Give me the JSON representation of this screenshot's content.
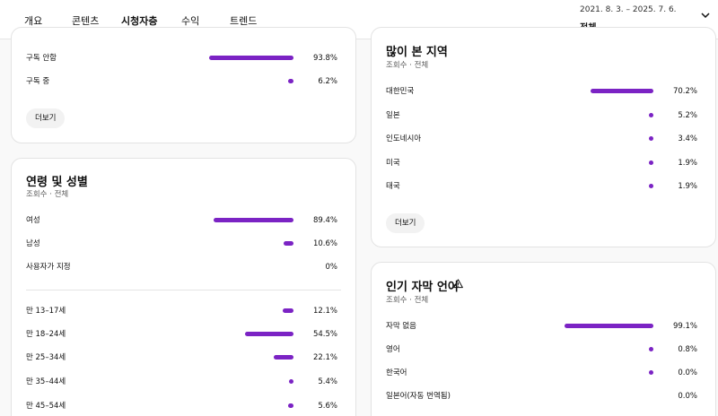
{
  "tabs": [
    {
      "label": "개요",
      "active": false
    },
    {
      "label": "콘텐츠",
      "active": false
    },
    {
      "label": "시청자층",
      "active": true
    },
    {
      "label": "수익",
      "active": false
    },
    {
      "label": "트렌드",
      "active": false
    }
  ],
  "date_range": {
    "dates": "2021. 8. 3. – 2025. 7. 6.",
    "scope": "전체"
  },
  "subscription_card": {
    "rows": [
      {
        "label": "구독 안함",
        "value": 93.8,
        "display": "93.8%"
      },
      {
        "label": "구독 중",
        "value": 6.2,
        "display": "6.2%"
      }
    ],
    "more_label": "더보기"
  },
  "age_gender_card": {
    "title": "연령 및 성별",
    "subtitle": "조회수 · 전체",
    "gender_rows": [
      {
        "label": "여성",
        "value": 89.4,
        "display": "89.4%"
      },
      {
        "label": "남성",
        "value": 10.6,
        "display": "10.6%"
      },
      {
        "label": "사용자가 지정",
        "value": 0,
        "display": "0%"
      }
    ],
    "age_rows": [
      {
        "label": "만 13–17세",
        "value": 12.1,
        "display": "12.1%"
      },
      {
        "label": "만 18–24세",
        "value": 54.5,
        "display": "54.5%"
      },
      {
        "label": "만 25–34세",
        "value": 22.1,
        "display": "22.1%"
      },
      {
        "label": "만 35–44세",
        "value": 5.4,
        "display": "5.4%"
      },
      {
        "label": "만 45–54세",
        "value": 5.6,
        "display": "5.6%"
      }
    ]
  },
  "geography_card": {
    "title": "많이 본 지역",
    "subtitle": "조회수 · 전체",
    "rows": [
      {
        "label": "대한민국",
        "value": 70.2,
        "display": "70.2%"
      },
      {
        "label": "일본",
        "value": 5.2,
        "display": "5.2%"
      },
      {
        "label": "인도네시아",
        "value": 3.4,
        "display": "3.4%"
      },
      {
        "label": "미국",
        "value": 1.9,
        "display": "1.9%"
      },
      {
        "label": "태국",
        "value": 1.9,
        "display": "1.9%"
      }
    ],
    "more_label": "더보기"
  },
  "subtitle_card": {
    "title": "인기 자막 언어",
    "subtitle": "조회수 · 전체",
    "rows": [
      {
        "label": "자막 없음",
        "value": 99.1,
        "display": "99.1%"
      },
      {
        "label": "영어",
        "value": 0.8,
        "display": "0.8%"
      },
      {
        "label": "한국어",
        "value": 0.04,
        "display": "0.0%"
      },
      {
        "label": "일본어(자동 번역됨)",
        "value": 0,
        "display": "0.0%"
      }
    ]
  },
  "colors": {
    "accent": "#7b23c4"
  }
}
